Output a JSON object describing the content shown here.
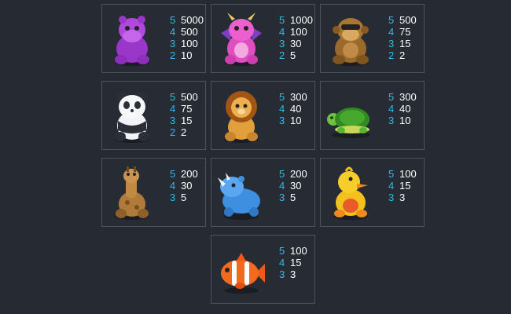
{
  "paytable": [
    {
      "symbol": "purple-hippo",
      "pays": [
        {
          "count": "5",
          "value": "5000"
        },
        {
          "count": "4",
          "value": "500"
        },
        {
          "count": "3",
          "value": "100"
        },
        {
          "count": "2",
          "value": "10"
        }
      ]
    },
    {
      "symbol": "pink-dragon",
      "pays": [
        {
          "count": "5",
          "value": "1000"
        },
        {
          "count": "4",
          "value": "100"
        },
        {
          "count": "3",
          "value": "30"
        },
        {
          "count": "2",
          "value": "5"
        }
      ]
    },
    {
      "symbol": "brown-monkey",
      "pays": [
        {
          "count": "5",
          "value": "500"
        },
        {
          "count": "4",
          "value": "75"
        },
        {
          "count": "3",
          "value": "15"
        },
        {
          "count": "2",
          "value": "2"
        }
      ]
    },
    {
      "symbol": "panda",
      "pays": [
        {
          "count": "5",
          "value": "500"
        },
        {
          "count": "4",
          "value": "75"
        },
        {
          "count": "3",
          "value": "15"
        },
        {
          "count": "2",
          "value": "2"
        }
      ]
    },
    {
      "symbol": "lion",
      "pays": [
        {
          "count": "5",
          "value": "300"
        },
        {
          "count": "4",
          "value": "40"
        },
        {
          "count": "3",
          "value": "10"
        }
      ]
    },
    {
      "symbol": "green-turtle",
      "pays": [
        {
          "count": "5",
          "value": "300"
        },
        {
          "count": "4",
          "value": "40"
        },
        {
          "count": "3",
          "value": "10"
        }
      ]
    },
    {
      "symbol": "giraffe",
      "pays": [
        {
          "count": "5",
          "value": "200"
        },
        {
          "count": "4",
          "value": "30"
        },
        {
          "count": "3",
          "value": "5"
        }
      ]
    },
    {
      "symbol": "blue-rhino",
      "pays": [
        {
          "count": "5",
          "value": "200"
        },
        {
          "count": "4",
          "value": "30"
        },
        {
          "count": "3",
          "value": "5"
        }
      ]
    },
    {
      "symbol": "yellow-duck",
      "pays": [
        {
          "count": "5",
          "value": "100"
        },
        {
          "count": "4",
          "value": "15"
        },
        {
          "count": "3",
          "value": "3"
        }
      ]
    },
    {
      "symbol": "clownfish",
      "pays": [
        {
          "count": "5",
          "value": "100"
        },
        {
          "count": "4",
          "value": "15"
        },
        {
          "count": "3",
          "value": "3"
        }
      ]
    }
  ],
  "colors": {
    "background": "#262b33",
    "border": "#4c535d",
    "count": "#35b8e6",
    "value": "#ffffff"
  }
}
